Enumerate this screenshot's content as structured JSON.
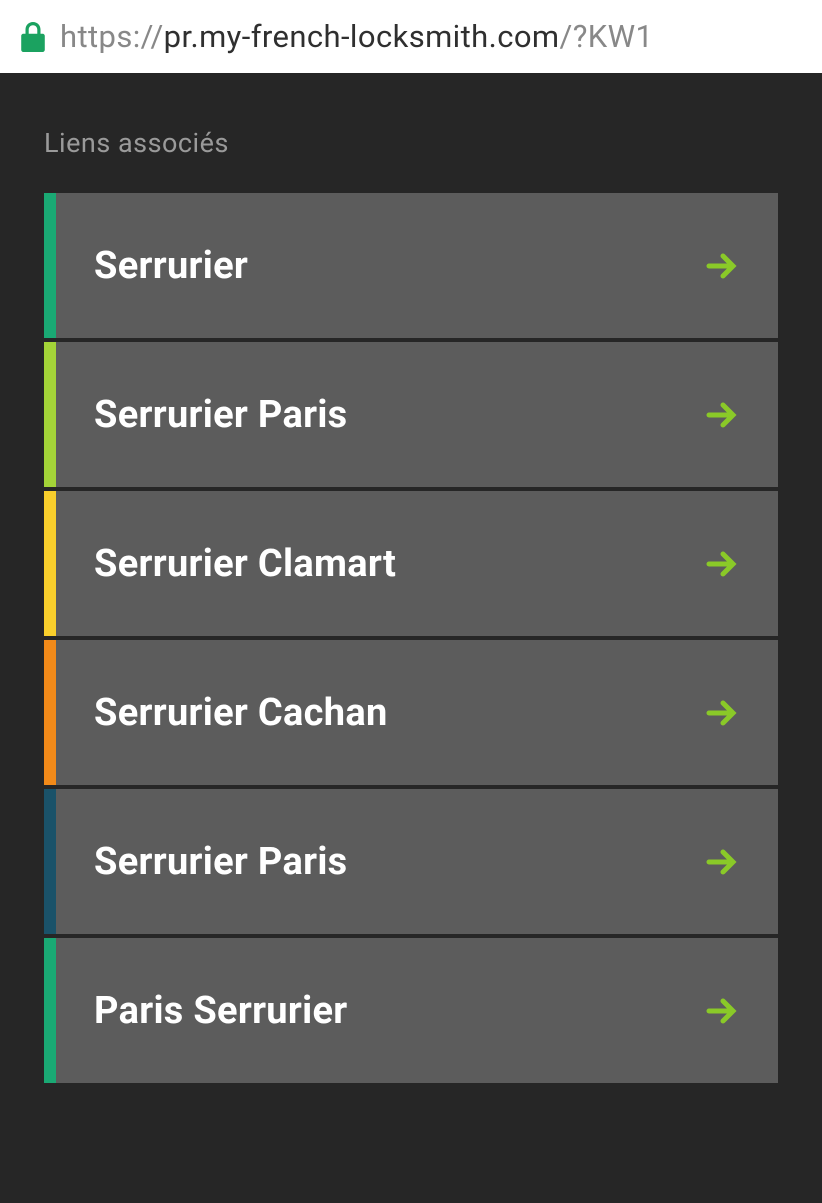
{
  "url": {
    "prefix": "https://",
    "domain": "pr.my-french-locksmith.com",
    "suffix": "/?KW1"
  },
  "section_title": "Liens associés",
  "links": [
    {
      "label": "Serrurier",
      "color": "#1aa974"
    },
    {
      "label": "Serrurier Paris",
      "color": "#a4d438"
    },
    {
      "label": "Serrurier Clamart",
      "color": "#f9cf2c"
    },
    {
      "label": "Serrurier Cachan",
      "color": "#f28a19"
    },
    {
      "label": "Serrurier Paris",
      "color": "#1a5269"
    },
    {
      "label": "Paris Serrurier",
      "color": "#1aa974"
    }
  ],
  "icons": {
    "lock_color": "#1ba260",
    "arrow_color": "#8ac928"
  }
}
